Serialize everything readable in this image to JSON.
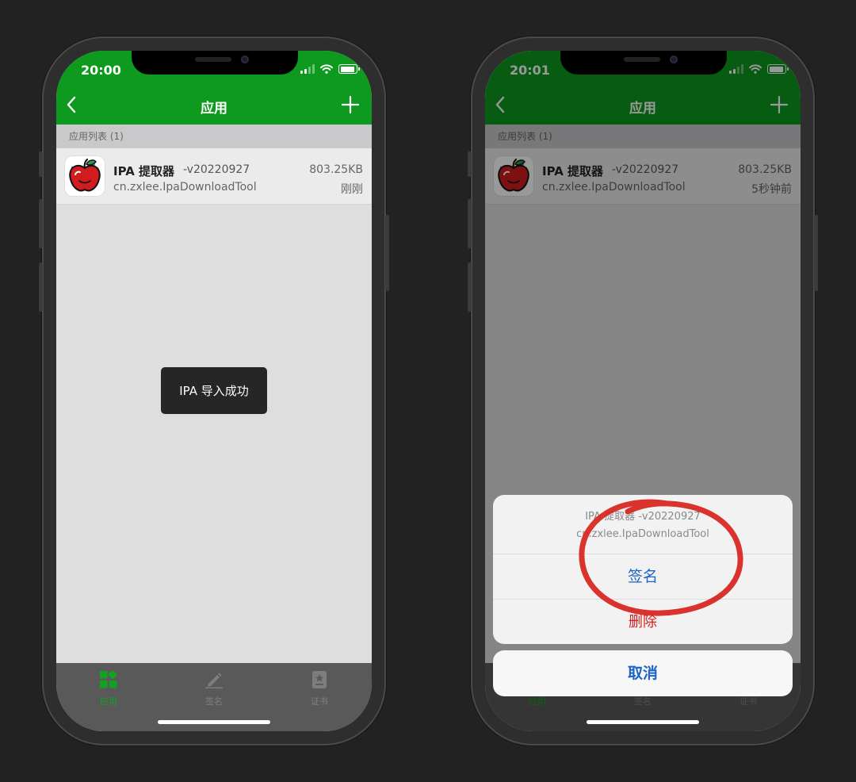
{
  "colors": {
    "header_green": "#0e9a1f",
    "tab_active": "#11a320",
    "action_blue": "#1a64c6",
    "destructive_red": "#d2201e",
    "annotation_red": "#d8231c"
  },
  "left_screen": {
    "status_time": "20:00",
    "nav": {
      "title": "应用",
      "back_icon": "chevron-left-icon",
      "add_icon": "plus-icon"
    },
    "section_header": "应用列表 (1)",
    "app_row": {
      "name": "IPA 提取器",
      "version": "-v20220927",
      "bundle_id": "cn.zxlee.IpaDownloadTool",
      "size": "803.25KB",
      "time": "刚刚",
      "icon": "apple-app-icon"
    },
    "toast": "IPA 导入成功",
    "tabs": [
      {
        "label": "应用",
        "icon": "grid-apps-icon",
        "active": true
      },
      {
        "label": "签名",
        "icon": "pencil-icon",
        "active": false
      },
      {
        "label": "证书",
        "icon": "certificate-icon",
        "active": false
      }
    ]
  },
  "right_screen": {
    "status_time": "20:01",
    "nav": {
      "title": "应用",
      "back_icon": "chevron-left-icon",
      "add_icon": "plus-icon"
    },
    "section_header": "应用列表 (1)",
    "app_row": {
      "name": "IPA 提取器",
      "version": "-v20220927",
      "bundle_id": "cn.zxlee.IpaDownloadTool",
      "size": "803.25KB",
      "time": "5秒钟前",
      "icon": "apple-app-icon"
    },
    "action_sheet": {
      "title": "IPA 提取器 -v20220927",
      "subtitle": "cn.zxlee.IpaDownloadTool",
      "options": [
        "签名",
        "删除"
      ],
      "cancel": "取消"
    },
    "tabs": [
      {
        "label": "应用",
        "icon": "grid-apps-icon",
        "active": true
      },
      {
        "label": "签名",
        "icon": "pencil-icon",
        "active": false
      },
      {
        "label": "证书",
        "icon": "certificate-icon",
        "active": false
      }
    ]
  }
}
